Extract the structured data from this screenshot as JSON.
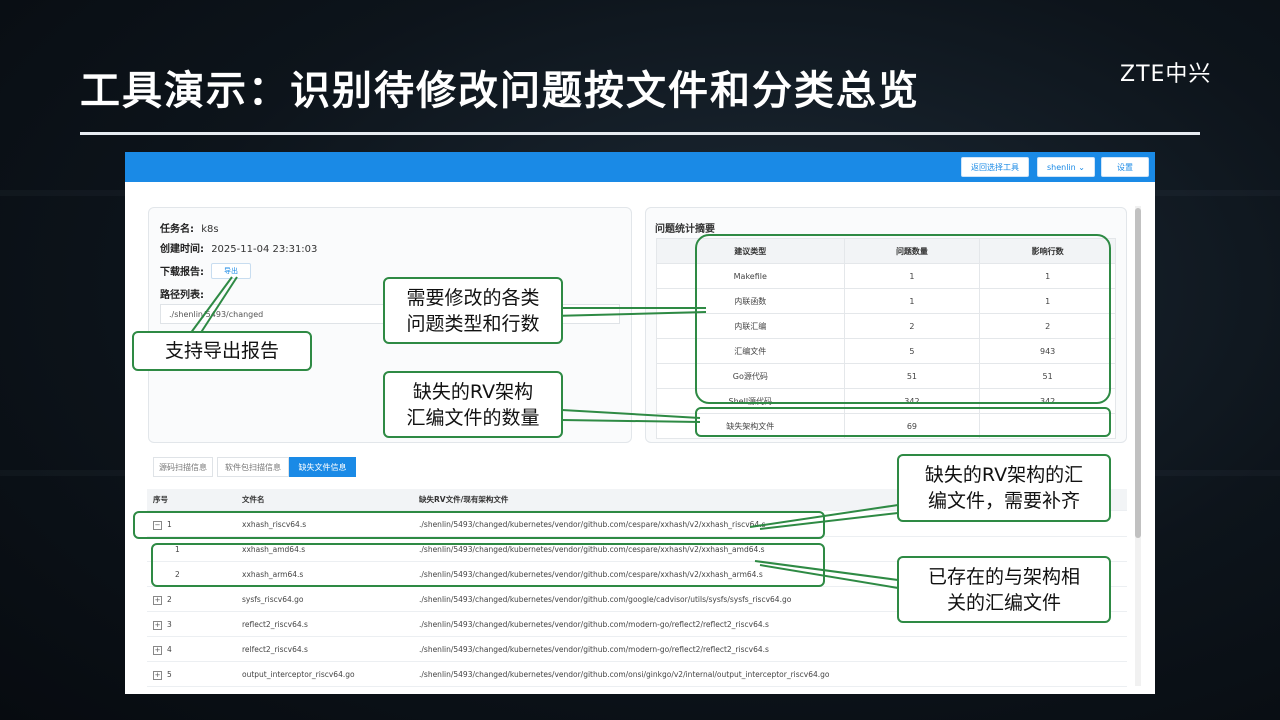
{
  "slide": {
    "title": "工具演示：识别待修改问题按文件和分类总览",
    "brand": "ZTE中兴"
  },
  "header": {
    "back_label": "返回选择工具",
    "user_label": "shenlin ⌄",
    "settings_label": "设置"
  },
  "task": {
    "name_label": "任务名:",
    "name_value": "k8s",
    "created_label": "创建时间:",
    "created_value": "2025-11-04 23:31:03",
    "report_label": "下载报告:",
    "export_label": "导出",
    "path_label": "路径列表:",
    "path_value": "./shenlin/5493/changed"
  },
  "summary": {
    "title": "问题统计摘要",
    "columns": [
      "建议类型",
      "问题数量",
      "影响行数"
    ],
    "rows": [
      [
        "Makefile",
        "1",
        "1"
      ],
      [
        "内联函数",
        "1",
        "1"
      ],
      [
        "内联汇编",
        "2",
        "2"
      ],
      [
        "汇编文件",
        "5",
        "943"
      ],
      [
        "Go源代码",
        "51",
        "51"
      ],
      [
        "Shell源代码",
        "342",
        "342"
      ],
      [
        "缺失架构文件",
        "69",
        ""
      ]
    ]
  },
  "tabs": [
    "源码扫描信息",
    "软件包扫描信息",
    "缺失文件信息"
  ],
  "files": {
    "columns": [
      "序号",
      "文件名",
      "缺失RV文件/现有架构文件"
    ],
    "rows": [
      {
        "toggle": "⊟",
        "index": "1",
        "name": "xxhash_riscv64.s",
        "path": "./shenlin/5493/changed/kubernetes/vendor/github.com/cespare/xxhash/v2/xxhash_riscv64.s"
      },
      {
        "toggle": "",
        "index": "1",
        "name": "xxhash_amd64.s",
        "path": "./shenlin/5493/changed/kubernetes/vendor/github.com/cespare/xxhash/v2/xxhash_amd64.s"
      },
      {
        "toggle": "",
        "index": "2",
        "name": "xxhash_arm64.s",
        "path": "./shenlin/5493/changed/kubernetes/vendor/github.com/cespare/xxhash/v2/xxhash_arm64.s"
      },
      {
        "toggle": "⊞",
        "index": "2",
        "name": "sysfs_riscv64.go",
        "path": "./shenlin/5493/changed/kubernetes/vendor/github.com/google/cadvisor/utils/sysfs/sysfs_riscv64.go"
      },
      {
        "toggle": "⊞",
        "index": "3",
        "name": "reflect2_riscv64.s",
        "path": "./shenlin/5493/changed/kubernetes/vendor/github.com/modern-go/reflect2/reflect2_riscv64.s"
      },
      {
        "toggle": "⊞",
        "index": "4",
        "name": "relfect2_riscv64.s",
        "path": "./shenlin/5493/changed/kubernetes/vendor/github.com/modern-go/reflect2/reflect2_riscv64.s"
      },
      {
        "toggle": "⊞",
        "index": "5",
        "name": "output_interceptor_riscv64.go",
        "path": "./shenlin/5493/changed/kubernetes/vendor/github.com/onsi/ginkgo/v2/internal/output_interceptor_riscv64.go"
      }
    ]
  },
  "callouts": {
    "export": "支持导出报告",
    "summary": "需要修改的各类\n问题类型和行数",
    "missing_count": "缺失的RV架构\n汇编文件的数量",
    "missing_files": "缺失的RV架构的汇\n编文件，需要补齐",
    "existing_files": "已存在的与架构相\n关的汇编文件"
  },
  "colors": {
    "accent": "#1a8ae6",
    "callout_border": "#2e8a44"
  }
}
